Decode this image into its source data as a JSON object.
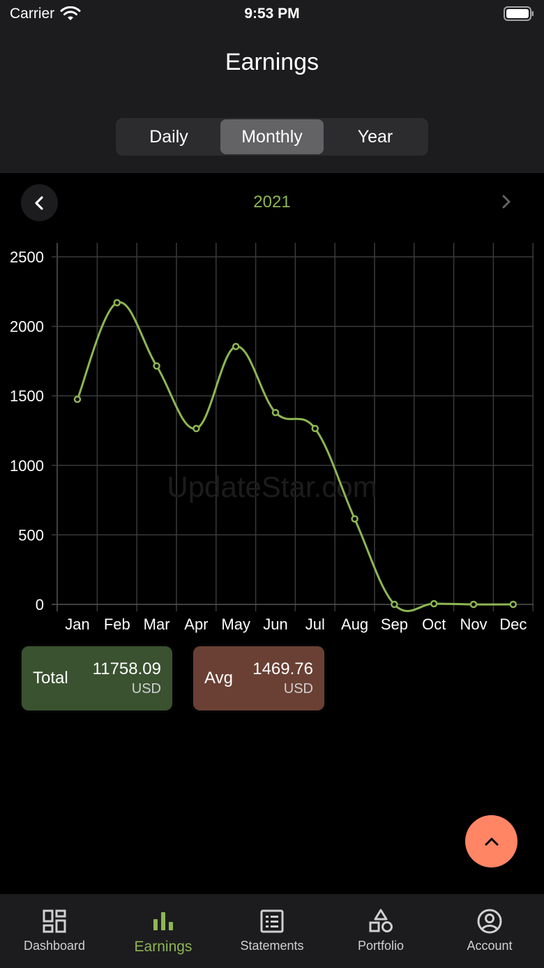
{
  "status_bar": {
    "carrier": "Carrier",
    "time": "9:53 PM"
  },
  "header": {
    "title": "Earnings"
  },
  "period_tabs": [
    {
      "label": "Daily",
      "active": false
    },
    {
      "label": "Monthly",
      "active": true
    },
    {
      "label": "Year",
      "active": false
    }
  ],
  "year_nav": {
    "year": "2021"
  },
  "colors": {
    "accent": "#8db653",
    "total_card": "#3a5230",
    "avg_card": "#6a4034",
    "fab": "#ff8565"
  },
  "chart_data": {
    "type": "line",
    "categories": [
      "Jan",
      "Feb",
      "Mar",
      "Apr",
      "May",
      "Jun",
      "Jul",
      "Aug",
      "Sep",
      "Oct",
      "Nov",
      "Dec"
    ],
    "series": [
      {
        "values": [
          1475,
          2170,
          1715,
          1265,
          1855,
          1380,
          1265,
          615,
          0,
          5,
          0,
          0
        ]
      }
    ],
    "ylim": [
      0,
      2500
    ],
    "yticks": [
      0,
      500,
      1000,
      1500,
      2000,
      2500
    ],
    "grid": true,
    "watermark": "UpdateStar.com"
  },
  "summary": {
    "total": {
      "label": "Total",
      "amount": "11758.09",
      "unit": "USD"
    },
    "avg": {
      "label": "Avg",
      "amount": "1469.76",
      "unit": "USD"
    }
  },
  "tab_bar": [
    {
      "label": "Dashboard",
      "icon": "dashboard-icon",
      "active": false
    },
    {
      "label": "Earnings",
      "icon": "bar-chart-icon",
      "active": true
    },
    {
      "label": "Statements",
      "icon": "statement-list-icon",
      "active": false
    },
    {
      "label": "Portfolio",
      "icon": "shapes-icon",
      "active": false
    },
    {
      "label": "Account",
      "icon": "user-circle-icon",
      "active": false
    }
  ]
}
